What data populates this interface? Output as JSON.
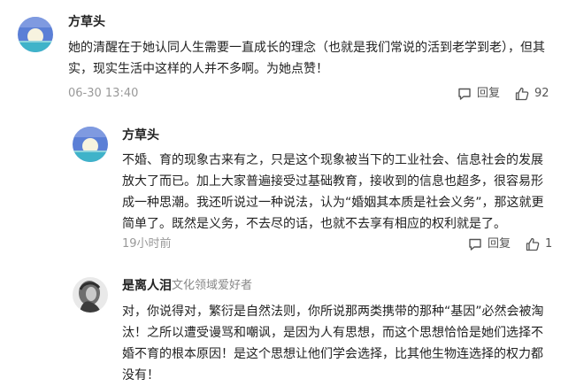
{
  "comments": [
    {
      "author": "方草头",
      "text": "她的清醒在于她认同人生需要一直成长的理念（也就是我们常说的活到老学到老），但其实，现实生活中这样的人并不多啊。为她点赞！",
      "time": "06-30 13:40",
      "reply_label": "回复",
      "likes": "92"
    },
    {
      "author": "方草头",
      "text": "不婚、育的现象古来有之，只是这个现象被当下的工业社会、信息社会的发展放大了而已。加上大家普遍接受过基础教育，接收到的信息也超多，很容易形成一种思潮。我还听说过一种说法，认为“婚姻其本质是社会义务”，那这就更简单了。既然是义务，不去尽的话，也就不去享有相应的权利就是了。",
      "time": "19小时前",
      "reply_label": "回复",
      "likes": "1"
    },
    {
      "author": "是离人泪",
      "badge": "文化领域爱好者",
      "text": "对，你说得对，繁衍是自然法则，你所说那两类携带的那种“基因”必然会被淘汰！之所以遭受谩骂和嘲讽，是因为人有思想，而这个思想恰恰是她们选择不婚不育的根本原因！是这个思想让他们学会选择，比其他生物连选择的权力都没有！"
    }
  ],
  "icons": {
    "reply": "comment-bubble-icon",
    "like": "thumbs-up-icon"
  },
  "colors": {
    "avatar_sky": "#5b7fd6",
    "avatar_sun": "#f7f3df",
    "avatar_sea": "#3fb3c9"
  }
}
